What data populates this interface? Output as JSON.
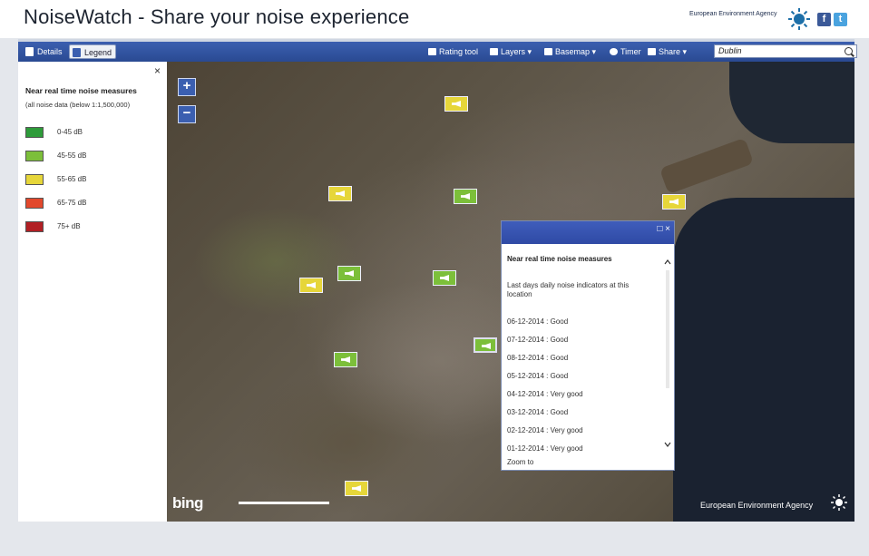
{
  "header": {
    "title": "NoiseWatch - Share your noise experience",
    "agency": "European Environment Agency",
    "social": [
      "f",
      "t"
    ]
  },
  "toolbar": {
    "tabs": [
      {
        "label": "Details",
        "icon": "info-icon"
      },
      {
        "label": "Legend",
        "icon": "list-icon"
      }
    ],
    "items": [
      {
        "label": "Rating tool",
        "icon": "pencil-icon"
      },
      {
        "label": "Layers",
        "icon": "layers-icon"
      },
      {
        "label": "Basemap",
        "icon": "grid-icon"
      },
      {
        "label": "Timer",
        "icon": "clock-icon"
      },
      {
        "label": "Share",
        "icon": "share-icon"
      }
    ],
    "search_value": "Dublin"
  },
  "legend": {
    "close": "×",
    "title": "Near real time noise measures",
    "subtitle": "(all noise data (below 1:1,500,000)",
    "items": [
      {
        "label": "0-45 dB",
        "color": "#2e9b3a"
      },
      {
        "label": "45-55 dB",
        "color": "#7cbf3a"
      },
      {
        "label": "55-65 dB",
        "color": "#e6d63a"
      },
      {
        "label": "65-75 dB",
        "color": "#e2482c"
      },
      {
        "label": "75+ dB",
        "color": "#b11f24"
      }
    ]
  },
  "map": {
    "zoom_in": "+",
    "zoom_out": "−",
    "provider": "bing",
    "credit": "European Environment Agency"
  },
  "popup": {
    "buttons": "□ ×",
    "title": "Near real time noise measures",
    "subtitle": "Last days daily noise indicators at this location",
    "rows": [
      "06-12-2014 : Good",
      "07-12-2014 : Good",
      "08-12-2014 : Good",
      "05-12-2014 : Good",
      "04-12-2014 : Very good",
      "03-12-2014 : Good",
      "02-12-2014 : Very good",
      "01-12-2014 : Very good"
    ],
    "footer": "Zoom to"
  }
}
